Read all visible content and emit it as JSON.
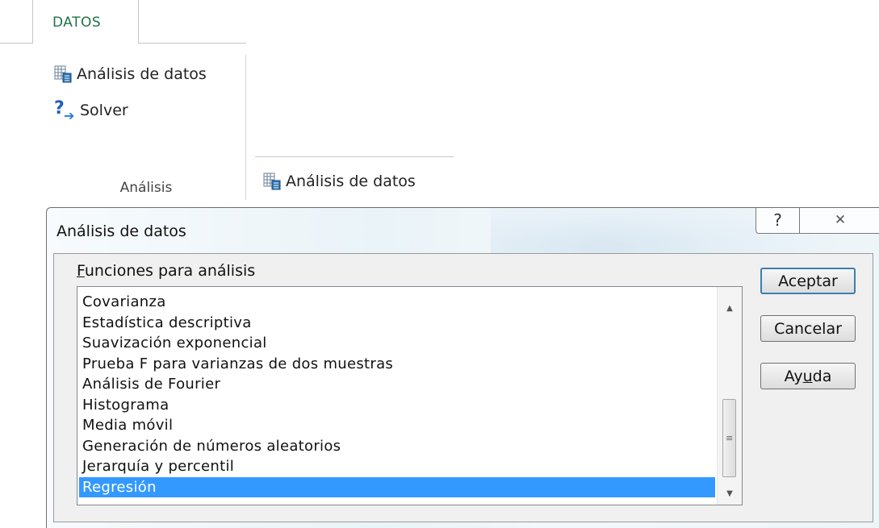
{
  "ribbon": {
    "tab_label": "DATOS",
    "group_label": "Análisis",
    "commands": [
      {
        "label": "Análisis de datos",
        "icon": "data-analysis-icon"
      },
      {
        "label": "Solver",
        "icon": "solver-icon"
      }
    ],
    "callout_label": "Análisis de datos",
    "tab_color": "#217346"
  },
  "dialog": {
    "title": "Análisis de datos",
    "help_glyph": "?",
    "close_glyph": "✕",
    "list_label_prefix": "F",
    "list_label_rest": "unciones para análisis",
    "items": [
      "Covarianza",
      "Estadística descriptiva",
      "Suavización exponencial",
      "Prueba F para varianzas de dos muestras",
      "Análisis de Fourier",
      "Histograma",
      "Media móvil",
      "Generación de números aleatorios",
      "Jerarquía y percentil",
      "Regresión"
    ],
    "selected_index": 9,
    "buttons": {
      "ok": "Aceptar",
      "cancel": "Cancelar",
      "help_pre": "Ay",
      "help_key": "u",
      "help_post": "da"
    },
    "selection_color": "#3399ff"
  }
}
